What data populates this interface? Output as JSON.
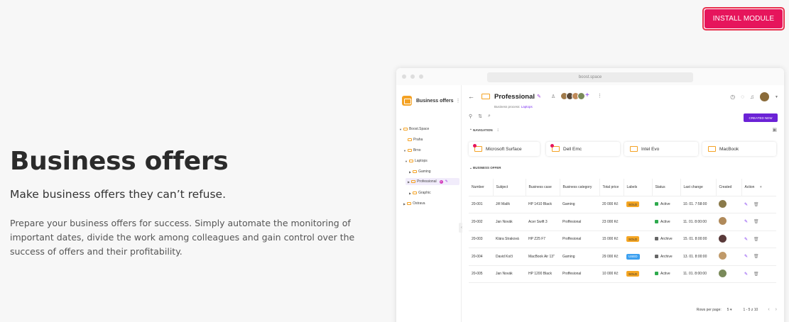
{
  "header": {
    "install_label": "INSTALL MODULE"
  },
  "hero": {
    "title": "Business offers",
    "subtitle": "Make business offers they can’t refuse.",
    "description": "Prepare your business offers for success. Simply automate the monitoring of important dates, divide the work among colleagues and gain control over the success of offers and their profitability."
  },
  "app": {
    "url": "boost.space",
    "sidebar": {
      "title": "Business offers",
      "items": [
        {
          "label": "Boost.Space"
        },
        {
          "label": "Praha"
        },
        {
          "label": "Brno"
        },
        {
          "label": "Laptops"
        },
        {
          "label": "Gaming"
        },
        {
          "label": "Professional"
        },
        {
          "label": "Graphic"
        },
        {
          "label": "Ostrava"
        }
      ]
    },
    "page": {
      "title": "Professional",
      "breadcrumb_prefix": "Business process:",
      "breadcrumb_link": "Laptops",
      "create_label": "CREATED NEW",
      "navigation_label": "NAVIGATION",
      "business_offer_label": "BUSINESS OFFER",
      "nav_cards": [
        "Microsoft Surface",
        "Dell Emc",
        "Intel Evo",
        "MacBook"
      ]
    },
    "table": {
      "headers": [
        "Number",
        "Subject",
        "Business case",
        "Business category",
        "Total price",
        "Labels",
        "Status",
        "Last change",
        "Created",
        "Action"
      ],
      "rows": [
        {
          "number": "20-001",
          "subject": "Jiří Malík",
          "case": "HP 1410 Black",
          "category": "Gaming",
          "price": "20 000 Kč",
          "label": "SOLD",
          "status": "Active",
          "change": "10. 01. 7:58:00"
        },
        {
          "number": "20-002",
          "subject": "Jan Novák",
          "case": "Acer Swift 3",
          "category": "Proffesional",
          "price": "23 000 Kč",
          "label": "",
          "status": "Active",
          "change": "11. 01. 8:00:00"
        },
        {
          "number": "20-003",
          "subject": "Klára Straková",
          "case": "HP Z25 F7",
          "category": "Proffesional",
          "price": "15 000 Kč",
          "label": "SOLD",
          "status": "Archive",
          "change": "15. 01. 8:00:00"
        },
        {
          "number": "20-004",
          "subject": "David Kočí",
          "case": "MacBook Air 13\"",
          "category": "Gaming",
          "price": "29 000 Kč",
          "label": "USED",
          "status": "Archive",
          "change": "13. 01. 8:00:00"
        },
        {
          "number": "20-005",
          "subject": "Jan Novák",
          "case": "HP 1200 Black",
          "category": "Proffesional",
          "price": "10 000 Kč",
          "label": "SOLD",
          "status": "Active",
          "change": "11. 01. 8:00:00"
        }
      ]
    },
    "pagination": {
      "rows_label": "Rows per page:",
      "rows_value": "5",
      "range": "1 - 5 z 10"
    },
    "colors": {
      "accent": "#e6155c",
      "purple": "#6b22d6",
      "sold": "#f5a623",
      "used": "#3ca0f0",
      "active": "#2eaa4d",
      "archive": "#666666"
    }
  }
}
